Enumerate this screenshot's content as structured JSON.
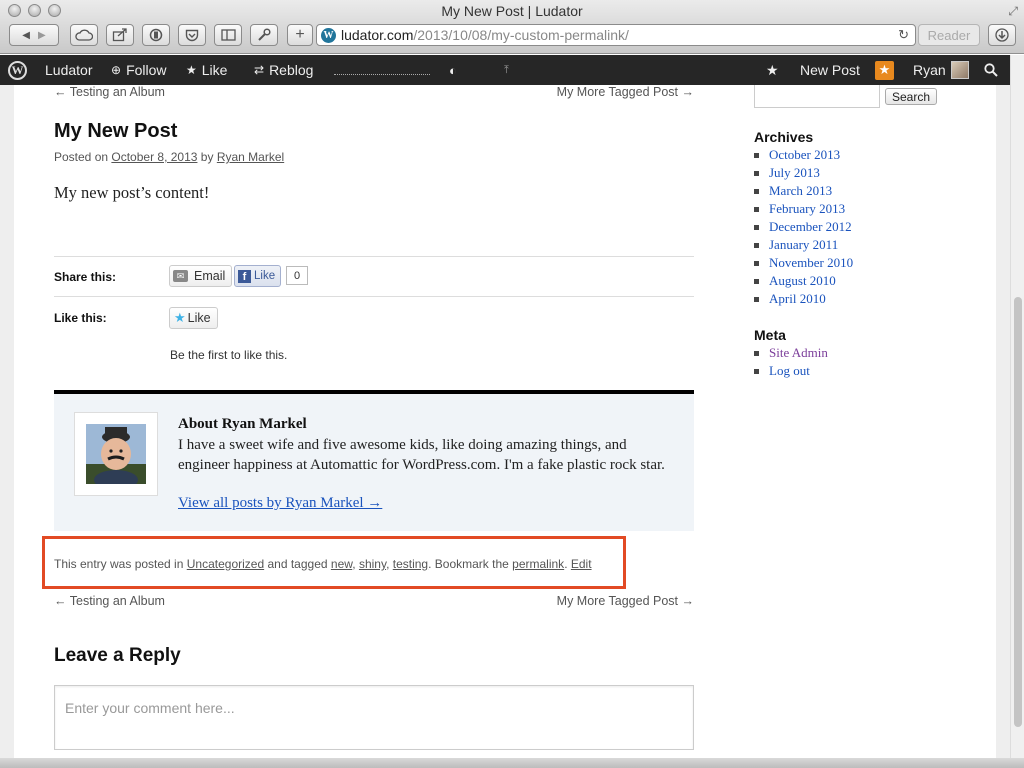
{
  "window": {
    "title": "My New Post | Ludator"
  },
  "toolbar": {
    "url_host": "ludator.com",
    "url_path": "/2013/10/08/my-custom-permalink/",
    "reader_label": "Reader"
  },
  "adminbar": {
    "site_name": "Ludator",
    "follow_label": "Follow",
    "like_label": "Like",
    "reblog_label": "Reblog",
    "new_post_label": "New Post",
    "user_name": "Ryan"
  },
  "post_nav": {
    "prev_label": "← Testing an Album",
    "next_label": "My More Tagged Post →"
  },
  "post": {
    "title": "My New Post",
    "meta_prefix": "Posted on",
    "date": "October 8, 2013",
    "meta_by": "by",
    "author": "Ryan Markel",
    "content": "My new post’s content!"
  },
  "sharing": {
    "share_label": "Share this:",
    "email_label": "Email",
    "fb_like_label": "Like",
    "fb_like_count": "0",
    "like_this_label": "Like this:",
    "like_button_label": "Like",
    "first_to_like": "Be the first to like this."
  },
  "author_box": {
    "heading": "About Ryan Markel",
    "bio": "I have a sweet wife and five awesome kids, like doing amazing things, and engineer happiness at Automattic for WordPress.com. I'm a fake plastic rock star.",
    "view_all_link": "View all posts by Ryan Markel →"
  },
  "entry_meta": {
    "text_1": "This entry was posted in",
    "category": "Uncategorized",
    "text_2": "and tagged",
    "tag_1": "new",
    "sep_1": ",",
    "tag_2": "shiny",
    "sep_2": ",",
    "tag_3": "testing",
    "text_3": ". Bookmark the",
    "permalink": "permalink",
    "text_4": ".",
    "edit": "Edit"
  },
  "comments": {
    "heading": "Leave a Reply",
    "placeholder": "Enter your comment here..."
  },
  "sidebar": {
    "search_button": "Search",
    "archives_title": "Archives",
    "archives": [
      {
        "label": "October 2013"
      },
      {
        "label": "July 2013"
      },
      {
        "label": "March 2013"
      },
      {
        "label": "February 2013"
      },
      {
        "label": "December 2012"
      },
      {
        "label": "January 2011"
      },
      {
        "label": "November 2010"
      },
      {
        "label": "August 2010"
      },
      {
        "label": "April 2010"
      }
    ],
    "meta_title": "Meta",
    "meta_links": [
      {
        "label": "Site Admin"
      },
      {
        "label": "Log out"
      }
    ]
  },
  "colors": {
    "adminbar_bg": "#262626",
    "link_blue": "#1a53bd",
    "visited_purple": "#7b3d9a",
    "highlight_red": "#e24a24",
    "notification_orange": "#e8891e"
  }
}
